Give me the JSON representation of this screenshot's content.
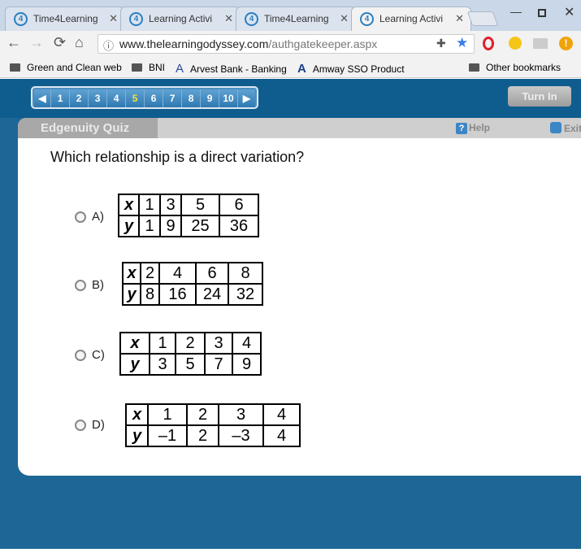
{
  "browser": {
    "tabs": [
      {
        "title": "Time4Learning",
        "active": false
      },
      {
        "title": "Learning Activi",
        "active": false
      },
      {
        "title": "Time4Learning",
        "active": false
      },
      {
        "title": "Learning Activi",
        "active": true
      }
    ],
    "url_host": "www.thelearningodyssey.com",
    "url_path": "/authgatekeeper.aspx",
    "bookmarks": [
      "Green and Clean web",
      "BNI",
      "Arvest Bank - Banking",
      "Amway SSO Product"
    ],
    "other_bookmarks": "Other bookmarks"
  },
  "quiz": {
    "pages": [
      "1",
      "2",
      "3",
      "4",
      "5",
      "6",
      "7",
      "8",
      "9",
      "10"
    ],
    "current_page": "5",
    "turn_in": "Turn In",
    "title": "Edgenuity Quiz",
    "help": "Help",
    "exit": "Exit",
    "question": "Which relationship is a direct variation?",
    "options": [
      {
        "label": "A)",
        "x": [
          "1",
          "3",
          "5",
          "6"
        ],
        "y": [
          "1",
          "9",
          "25",
          "36"
        ]
      },
      {
        "label": "B)",
        "x": [
          "2",
          "4",
          "6",
          "8"
        ],
        "y": [
          "8",
          "16",
          "24",
          "32"
        ]
      },
      {
        "label": "C)",
        "x": [
          "1",
          "2",
          "3",
          "4"
        ],
        "y": [
          "3",
          "5",
          "7",
          "9"
        ]
      },
      {
        "label": "D)",
        "x": [
          "1",
          "2",
          "3",
          "4"
        ],
        "y": [
          "–1",
          "2",
          "–3",
          "4"
        ]
      }
    ],
    "row_labels": {
      "x": "x",
      "y": "y"
    }
  },
  "colors": {
    "brand_blue": "#1d6796",
    "header_blue": "#0f5d8f",
    "current_page": "#f5e23a"
  }
}
